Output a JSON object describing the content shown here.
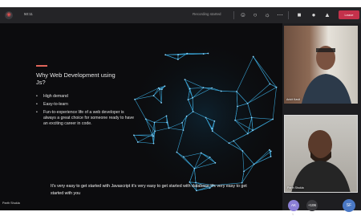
{
  "toolbar": {
    "meeting_time": "50:11",
    "recording_status": "Recording started",
    "leave_label": "Leave",
    "icons": [
      "people-icon",
      "chat-icon",
      "reactions-icon",
      "more-icon",
      "camera-icon",
      "mic-icon",
      "share-icon"
    ]
  },
  "slide": {
    "title": "Why Web Development using Js?",
    "bullets": [
      "High demand",
      "Easy-to-learn",
      "Fun-to-experience life of a web developer is always a great choice for someone ready to have an exciting career in code."
    ]
  },
  "caption": "It's very easy to get started with Javascript it's very easy to get started with database It's very easy to get started with you",
  "presenter": "Parth Shukla",
  "participants": [
    {
      "name": "Ankit Kavit"
    },
    {
      "name": "Parth Shukla"
    }
  ],
  "avatars": {
    "first_initials": "AK",
    "first_sub": "N",
    "more_count": "+106",
    "last_initials": "SF"
  },
  "colors": {
    "leave": "#c4314b",
    "accent": "#e0655a",
    "globe": "#3fb8f0"
  }
}
